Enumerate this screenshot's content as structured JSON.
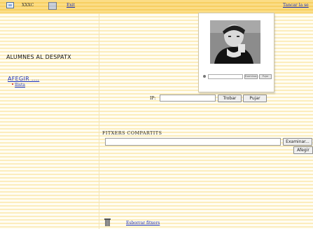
{
  "toolbar": {
    "host_label": "XXXC",
    "exit_label": "Exit",
    "close_label": "Tancar la se"
  },
  "photo_panel": {
    "file_button": "Examinar...",
    "upload_button": "Pujar"
  },
  "students": {
    "heading": "ALUMNES AL DESPATX",
    "add_label": "AFEGIR ....",
    "list_link": "llista"
  },
  "ip_form": {
    "label": "IP:",
    "value": "",
    "search_button": "Trobar",
    "upload_button": "Pujar"
  },
  "shared_files": {
    "title": "FITXERS COMPARTITS",
    "file_value": "",
    "browse_button": "Examinar...",
    "add_button": "Afegir"
  },
  "footer": {
    "delete_link": "Esborrar fitxers"
  }
}
